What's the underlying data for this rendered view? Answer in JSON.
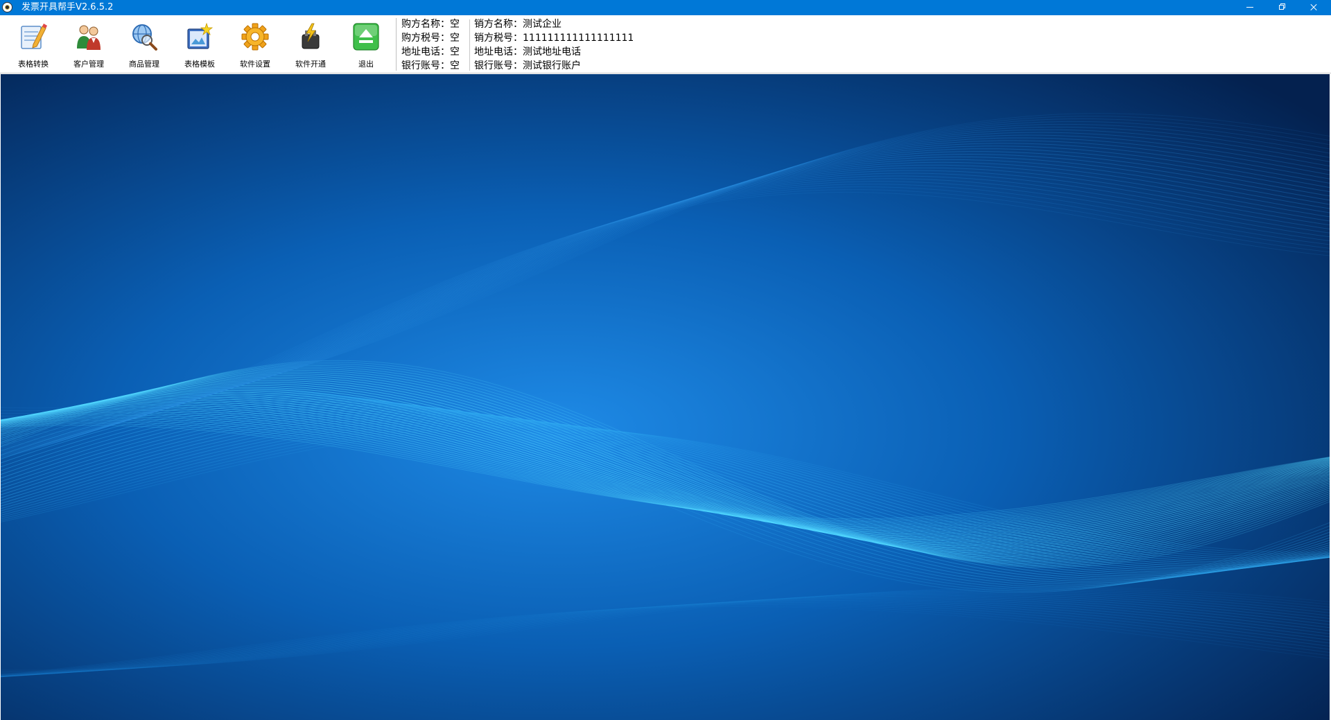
{
  "window": {
    "title": "发票开具帮手V2.6.5.2"
  },
  "toolbar": {
    "buttons": [
      {
        "label": "表格转换",
        "icon": "edit-table-icon"
      },
      {
        "label": "客户管理",
        "icon": "customers-icon"
      },
      {
        "label": "商品管理",
        "icon": "goods-search-icon"
      },
      {
        "label": "表格模板",
        "icon": "template-icon"
      },
      {
        "label": "软件设置",
        "icon": "gear-icon"
      },
      {
        "label": "软件开通",
        "icon": "activate-icon"
      },
      {
        "label": "退出",
        "icon": "exit-icon"
      }
    ]
  },
  "buyer": {
    "name": "购方名称：空",
    "tax_id": "购方税号：空",
    "address_phone": "地址电话：空",
    "bank_account": "银行账号：空"
  },
  "seller": {
    "name": "销方名称：测试企业",
    "tax_id": "销方税号：111111111111111111",
    "address_phone": "地址电话：测试地址电话",
    "bank_account": "银行账号：测试银行账户"
  },
  "colors": {
    "titlebar": "#0078d7",
    "background_dark": "#04214f",
    "background_mid": "#0a5fb4",
    "wave_light": "#3ed0ff"
  }
}
